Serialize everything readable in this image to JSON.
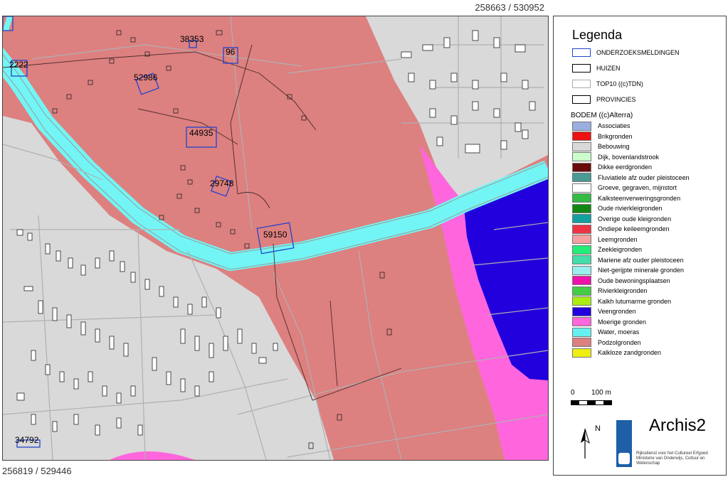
{
  "coords": {
    "top_right": "258663 / 530952",
    "bottom_left": "256819 / 529446"
  },
  "map": {
    "labels": [
      "38353",
      "96",
      "2222",
      "52986",
      "44935",
      "29748",
      "59150",
      "34792"
    ],
    "colors": {
      "leem": "#dd8080",
      "bebouwing": "#d9d9d9",
      "water": "#73f5f5",
      "veen": "#2200dd",
      "moerig": "#ff66dd"
    }
  },
  "legend": {
    "title": "Legenda",
    "layers": [
      {
        "label": "ONDERZOEKSMELDINGEN",
        "border": "#2244cc"
      },
      {
        "label": "HUIZEN",
        "border": "#000000"
      },
      {
        "label": "TOP10 ((c)TDN)",
        "border": "#aaaaaa"
      },
      {
        "label": "PROVINCIES",
        "border": "#000000"
      }
    ],
    "bodem_title": "BODEM ((c)Alterra)",
    "bodem": [
      {
        "label": "Associaties",
        "color": "#9aaedf"
      },
      {
        "label": "Brikgronden",
        "color": "#ee1111"
      },
      {
        "label": "Bebouwing",
        "color": "#d9d9d9"
      },
      {
        "label": "Dijk, bovenlandstrook",
        "color": "#ccffcc"
      },
      {
        "label": "Dikke eerdgronden",
        "color": "#6b0b0b"
      },
      {
        "label": "Fluviatiele afz ouder pleistoceen",
        "color": "#4a9a96"
      },
      {
        "label": "Groeve, gegraven, mijnstort",
        "color": "#ffffff"
      },
      {
        "label": "Kalksteenverweringsgronden",
        "color": "#33bb44"
      },
      {
        "label": "Oude rivierkleigronden",
        "color": "#118811"
      },
      {
        "label": "Overige oude kleigronden",
        "color": "#11a0a0"
      },
      {
        "label": "Ondiepe keileemgronden",
        "color": "#ee3344"
      },
      {
        "label": "Leemgronden",
        "color": "#f4a0a0"
      },
      {
        "label": "Zeekleigronden",
        "color": "#22ee77"
      },
      {
        "label": "Mariene afz ouder pleistoceen",
        "color": "#44ddaa"
      },
      {
        "label": "Niet-gerijpte minerale gronden",
        "color": "#99eeee"
      },
      {
        "label": "Oude bewoningsplaatsen",
        "color": "#ee11aa"
      },
      {
        "label": "Rivierkleigronden",
        "color": "#44cc44"
      },
      {
        "label": "Kalkh lutumarme gronden",
        "color": "#aaee11"
      },
      {
        "label": "Veengronden",
        "color": "#2200dd"
      },
      {
        "label": "Moerige gronden",
        "color": "#ff66dd"
      },
      {
        "label": "Water, moeras",
        "color": "#66f0f0"
      },
      {
        "label": "Podzolgronden",
        "color": "#dd8080"
      },
      {
        "label": "Kalkloze zandgronden",
        "color": "#eeee11"
      }
    ],
    "scale": {
      "start": "0",
      "end": "100 m"
    },
    "north": "N",
    "app_title": "Archis2",
    "institution": "Rijksdienst voor het Cultureel Erfgoed Ministerie van Onderwijs, Cultuur en Wetenschap"
  }
}
